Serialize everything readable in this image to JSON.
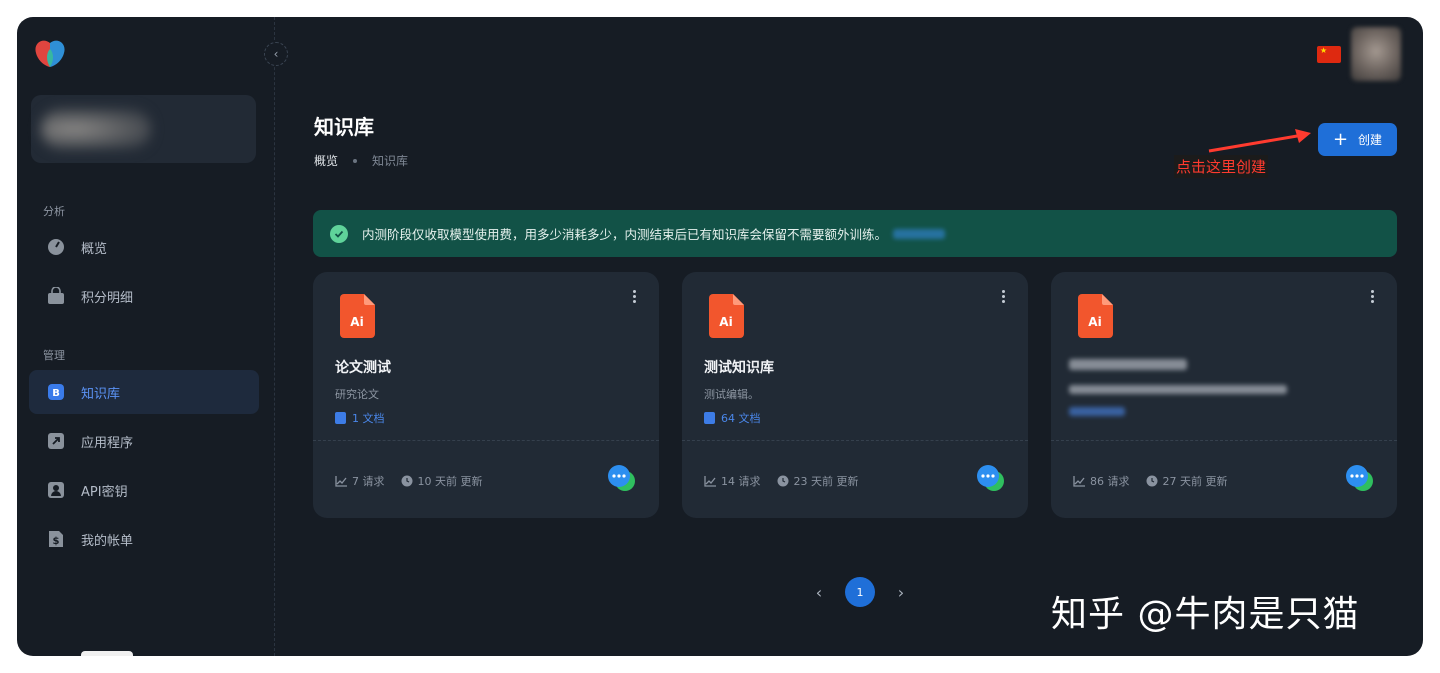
{
  "header": {
    "title": "知识库",
    "breadcrumb": [
      "概览",
      "知识库"
    ],
    "create_label": "创建",
    "annotation": "点击这里创建"
  },
  "sidebar": {
    "sections": [
      {
        "label": "分析",
        "items": [
          {
            "label": "概览",
            "icon": "dashboard-icon"
          },
          {
            "label": "积分明细",
            "icon": "bag-icon"
          }
        ]
      },
      {
        "label": "管理",
        "items": [
          {
            "label": "知识库",
            "icon": "knowledge-base-icon",
            "active": true
          },
          {
            "label": "应用程序",
            "icon": "app-arrow-icon"
          },
          {
            "label": "API密钥",
            "icon": "user-key-icon"
          },
          {
            "label": "我的帐单",
            "icon": "bill-icon"
          }
        ]
      }
    ]
  },
  "notice": {
    "text": "内测阶段仅收取模型使用费，用多少消耗多少，内测结束后已有知识库会保留不需要额外训练。"
  },
  "cards": [
    {
      "name": "论文测试",
      "description": "研究论文",
      "docs": "1 文档",
      "requests": "7 请求",
      "updated": "10 天前 更新",
      "file_badge": "Ai"
    },
    {
      "name": "测试知识库",
      "description": "测试编辑。",
      "docs": "64 文档",
      "requests": "14 请求",
      "updated": "23 天前 更新",
      "file_badge": "Ai"
    },
    {
      "name": "",
      "description": "",
      "docs": "",
      "requests": "86 请求",
      "updated": "27 天前 更新",
      "file_badge": "Ai"
    }
  ],
  "pagination": {
    "current": "1",
    "prev": "‹",
    "next": "›"
  },
  "watermark": "知乎 @牛肉是只猫",
  "colors": {
    "accent": "#1f6fd8",
    "notice_bg": "#125247",
    "annotation": "#ff3b2f",
    "file_icon": "#f2562d"
  }
}
